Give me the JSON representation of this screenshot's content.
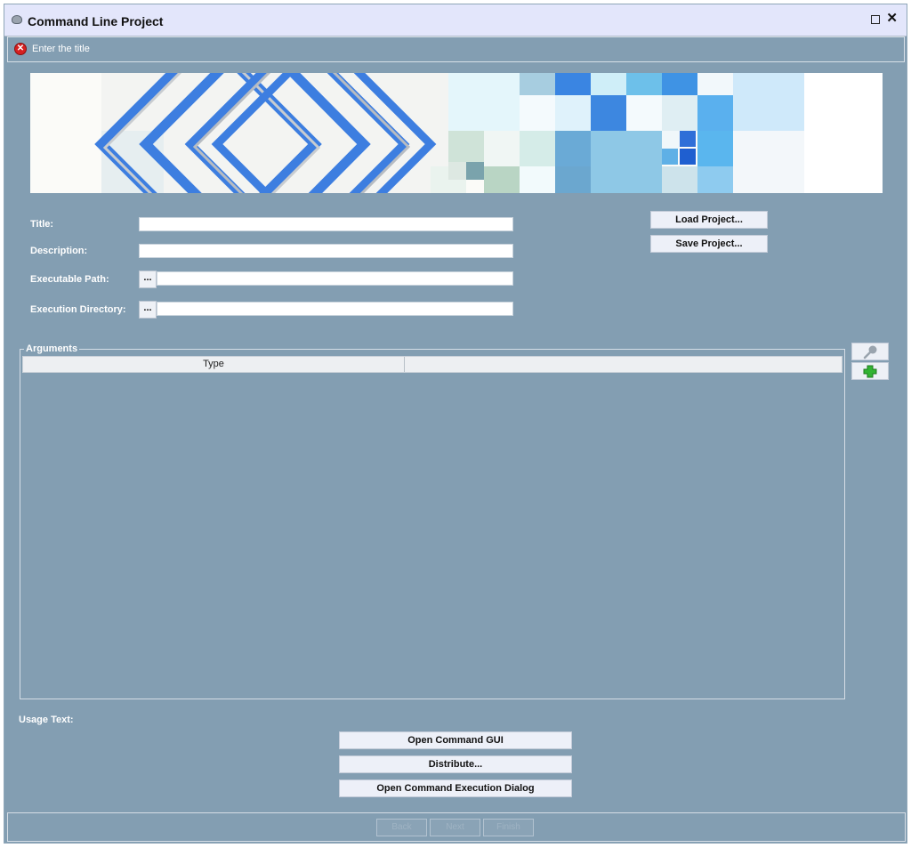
{
  "window": {
    "title": "Command Line Project",
    "maximize_icon": "maximize-icon",
    "close_glyph": "✕"
  },
  "message": {
    "text": "Enter the title",
    "icon": "error-icon",
    "icon_glyph": "✕"
  },
  "form": {
    "title_label": "Title:",
    "description_label": "Description:",
    "executable_label": "Executable Path:",
    "directory_label": "Execution Directory:",
    "browse_label": "...",
    "title_value": "",
    "description_value": "",
    "executable_value": "",
    "directory_value": ""
  },
  "project_buttons": {
    "load": "Load Project...",
    "save": "Save Project..."
  },
  "arguments": {
    "legend": "Arguments",
    "columns": [
      "Type",
      ""
    ],
    "rows": [],
    "edit_icon": "key-icon",
    "add_icon": "plus-icon"
  },
  "usage": {
    "label": "Usage Text:"
  },
  "actions": {
    "open_gui": "Open Command GUI",
    "distribute": "Distribute...",
    "open_execution": "Open Command Execution Dialog"
  },
  "footer": {
    "buttons": [
      "Back",
      "Next",
      "Finish"
    ]
  },
  "colors": {
    "panel": "#839eb2",
    "titlebar": "#e3e6fb",
    "accent_blue": "#3d7ee0",
    "error_red": "#d62020",
    "add_green": "#32b432"
  }
}
